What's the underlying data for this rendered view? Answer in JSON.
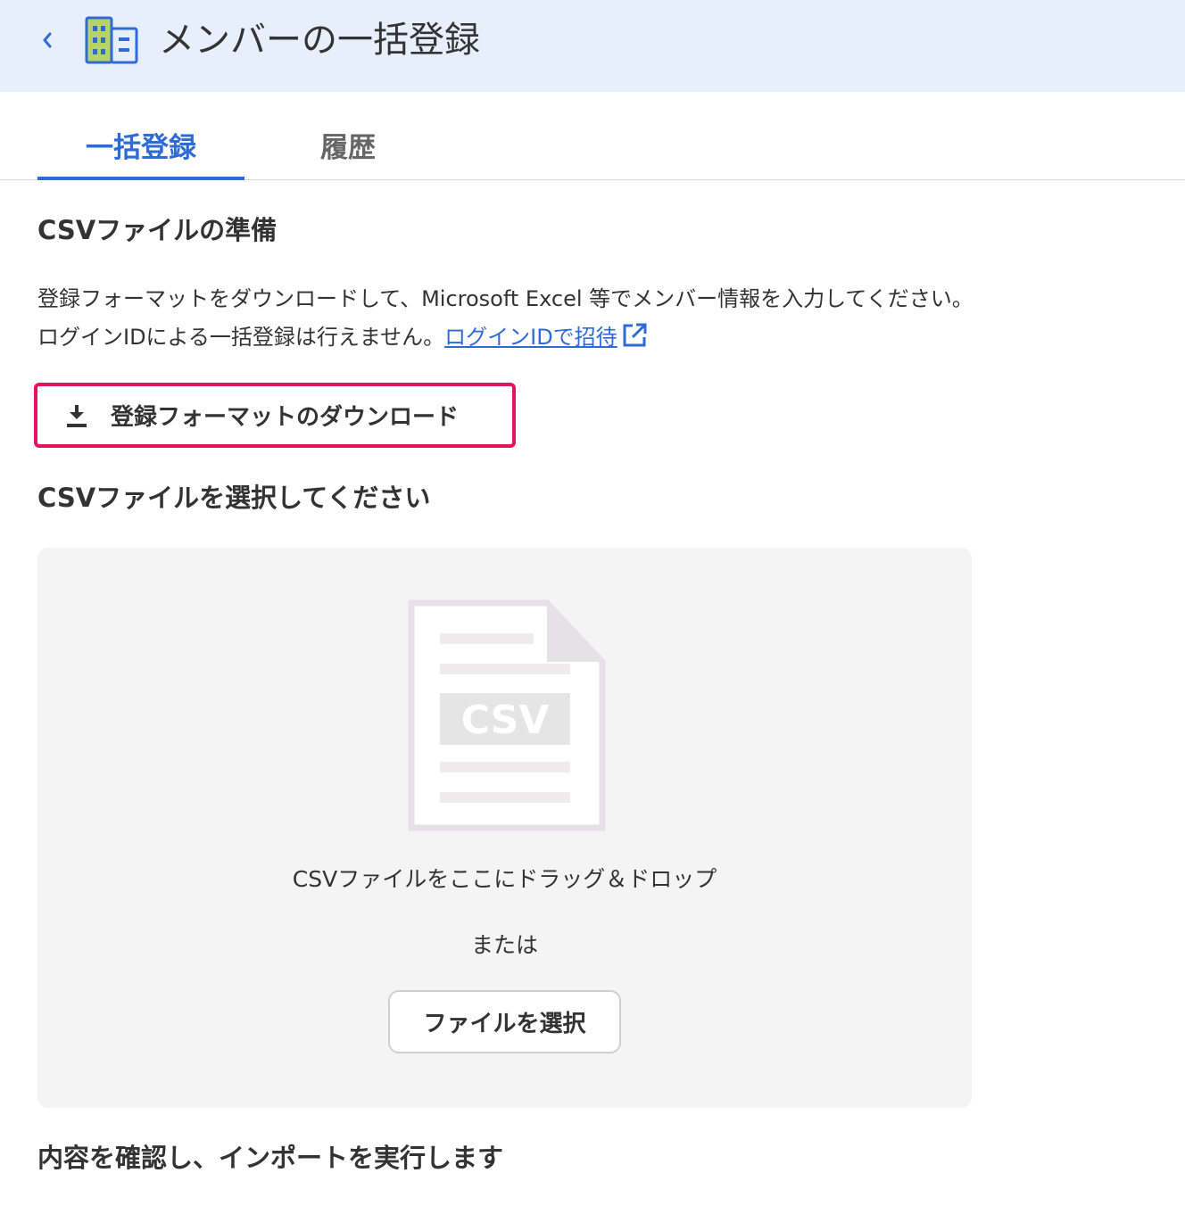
{
  "header": {
    "title": "メンバーの一括登録",
    "accent_color": "#2f6bd6",
    "background_color": "#e8effc"
  },
  "tabs": [
    {
      "label": "一括登録",
      "active": true
    },
    {
      "label": "履歴",
      "active": false
    }
  ],
  "sections": {
    "prepare_title": "CSVファイルの準備",
    "description_line1": "登録フォーマットをダウンロードして、Microsoft Excel 等でメンバー情報を入力してください。",
    "description_line2": "ログインIDによる一括登録は行えません。",
    "invite_link": "ログインIDで招待",
    "download_button": "登録フォーマットのダウンロード",
    "select_title": "CSVファイルを選択してください",
    "confirm_title": "内容を確認し、インポートを実行します"
  },
  "dropzone": {
    "illustration_label": "CSV",
    "drag_text": "CSVファイルをここにドラッグ＆ドロップ",
    "or_text": "または",
    "select_button": "ファイルを選択"
  },
  "icons": {
    "back": "chevron-left-icon",
    "header": "building-icon",
    "external_link": "external-link-icon",
    "download": "download-icon",
    "file": "csv-file-icon"
  },
  "highlight_color": "#e3115e"
}
